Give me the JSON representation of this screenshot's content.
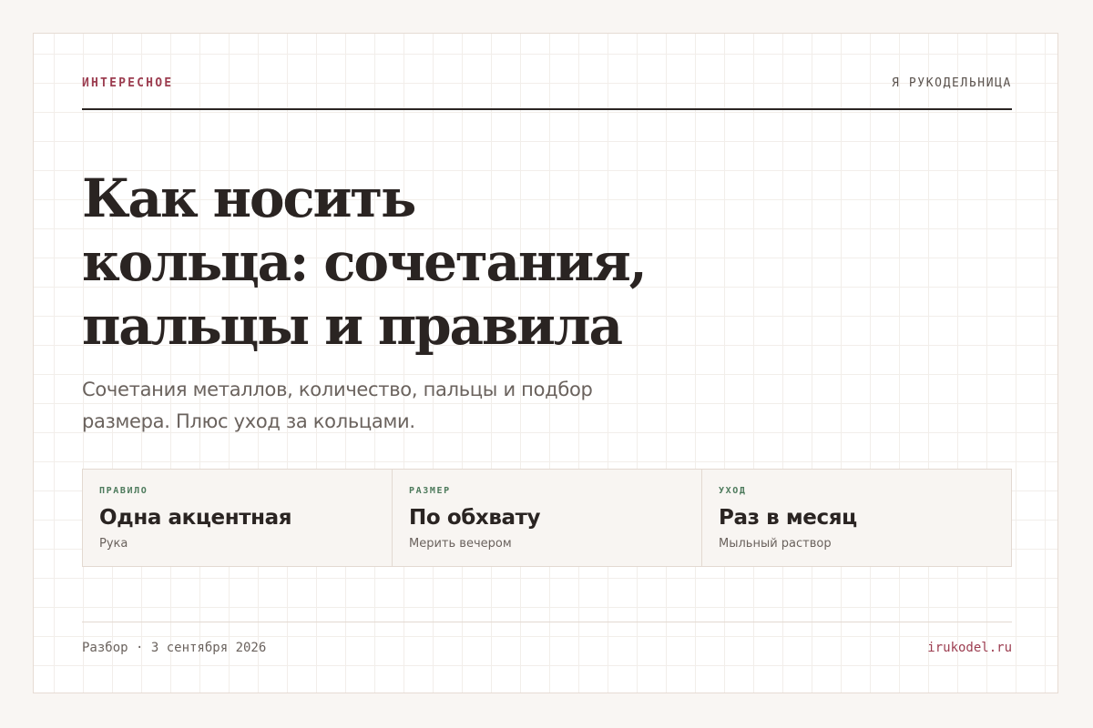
{
  "header": {
    "eyebrow": "ИНТЕРЕСНОЕ",
    "brand": "Я РУКОДЕЛЬНИЦА"
  },
  "article": {
    "title_lines": [
      "Как носить",
      "кольца: сочетания,",
      "пальцы и правила"
    ],
    "subtitle_lines": [
      "Сочетания металлов, количество, пальцы и подбор",
      "размера. Плюс уход за кольцами."
    ]
  },
  "stats": [
    {
      "label": "ПРАВИЛО",
      "value": "Одна акцентная",
      "note": "Рука"
    },
    {
      "label": "РАЗМЕР",
      "value": "По обхвату",
      "note": "Мерить вечером"
    },
    {
      "label": "УХОД",
      "value": "Раз в месяц",
      "note": "Мыльный раствор"
    }
  ],
  "footer": {
    "meta": "Разбор · 3 сентября 2026",
    "domain": "irukodel.ru"
  },
  "colors": {
    "accent": "#9c3d50",
    "label_green": "#4d7a5c",
    "ink": "#2a2422",
    "muted": "#6a625d",
    "page_background": "#f9f6f3"
  }
}
